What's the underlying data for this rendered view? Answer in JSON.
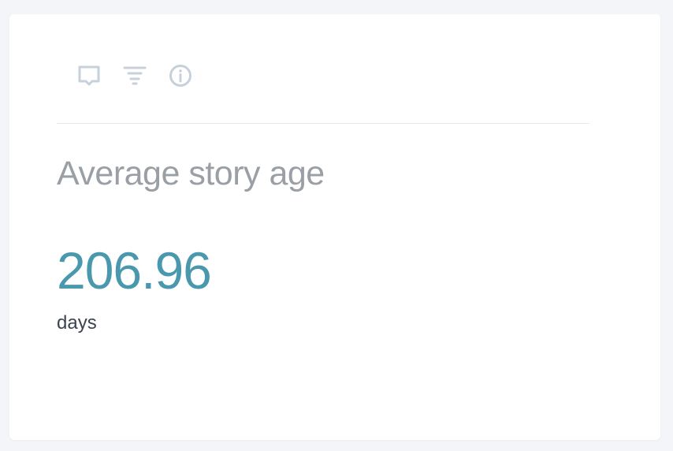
{
  "toolbar": {
    "icons": [
      "comment-icon",
      "filter-icon",
      "info-icon"
    ]
  },
  "metric": {
    "title": "Average story age",
    "value": "206.96",
    "unit": "days"
  },
  "colors": {
    "background": "#f3f5f8",
    "card": "#ffffff",
    "icon": "#c6d1db",
    "title": "#9a9fa6",
    "value": "#4a98ad",
    "unit": "#3b4450"
  }
}
